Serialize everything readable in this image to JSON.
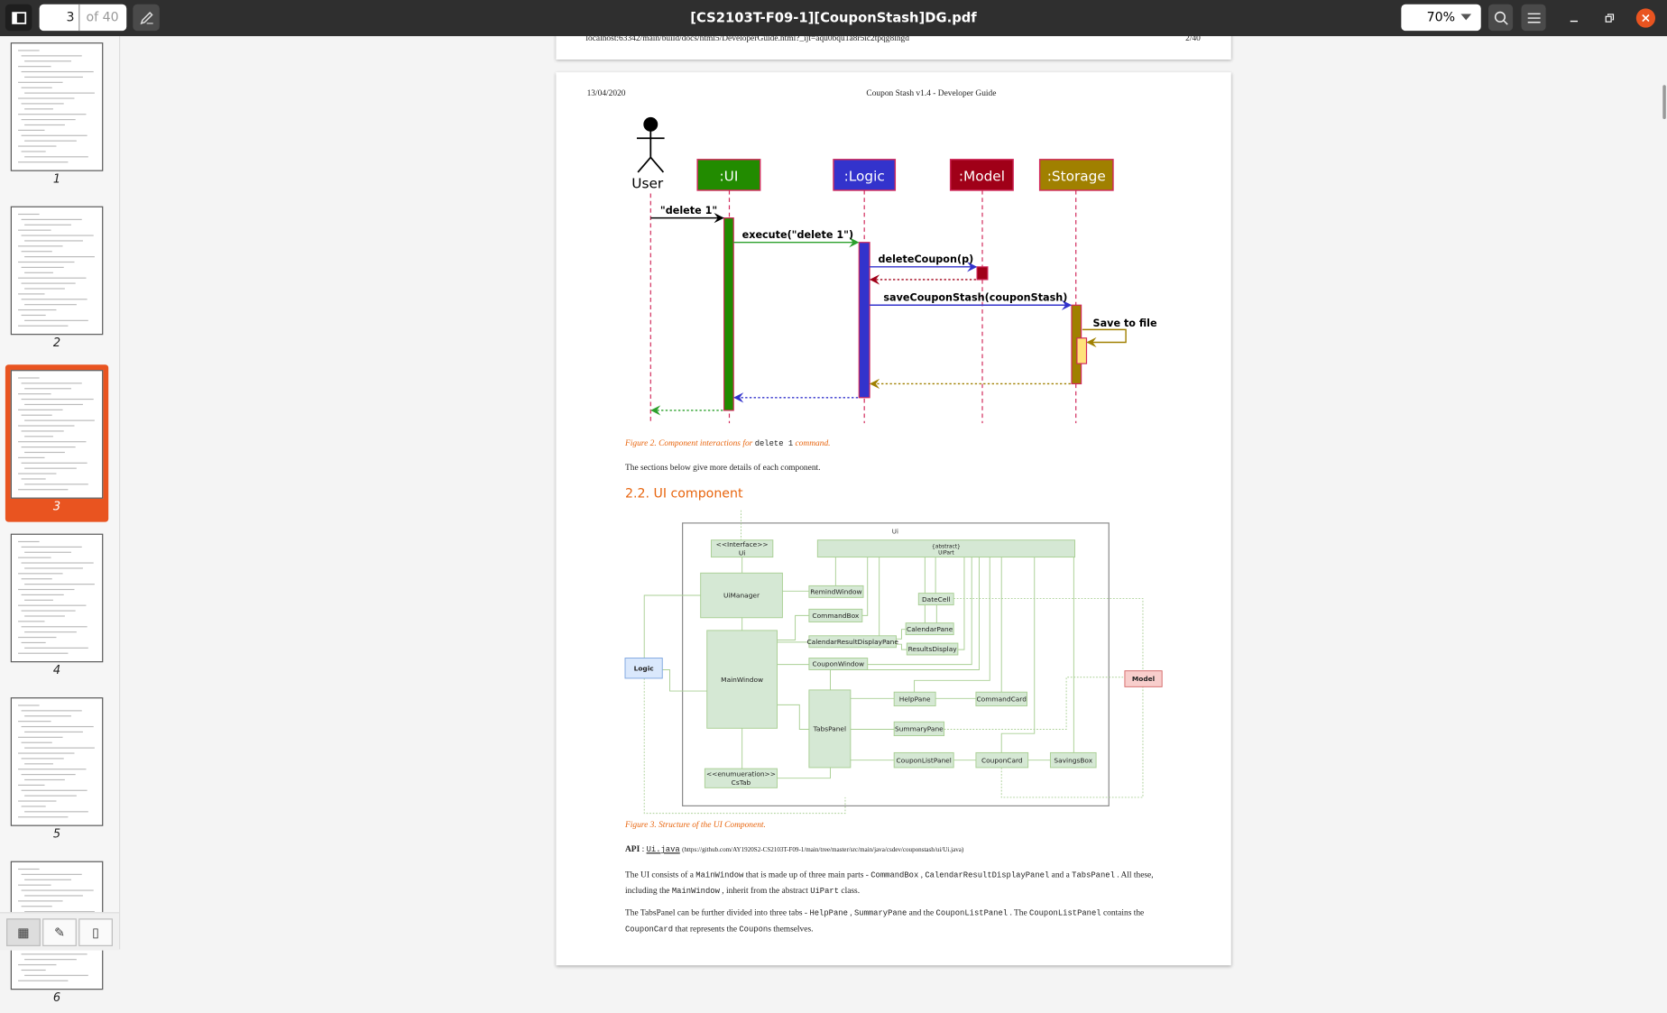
{
  "toolbar": {
    "current_page": "3",
    "page_count": "of 40",
    "document_title": "[CS2103T-F09-1][CouponStash]DG.pdf",
    "zoom_level": "70%"
  },
  "sidebar": {
    "thumbnails": [
      {
        "label": "1"
      },
      {
        "label": "2"
      },
      {
        "label": "3",
        "selected": true
      },
      {
        "label": "4"
      },
      {
        "label": "5"
      },
      {
        "label": "6"
      }
    ]
  },
  "page2_footer": {
    "url": "localhost:63342/main/build/docs/html5/DeveloperGuide.html?_ijt=aqu0bqu1a8r5ic2tpqg8lngd",
    "page": "2/40"
  },
  "page3": {
    "header_date": "13/04/2020",
    "header_title": "Coupon Stash v1.4 - Developer Guide",
    "sequence": {
      "actor": "User",
      "participants": [
        {
          "label": ":UI",
          "color": "#228b00"
        },
        {
          "label": ":Logic",
          "color": "#3333cc"
        },
        {
          "label": ":Model",
          "color": "#a00018"
        },
        {
          "label": ":Storage",
          "color": "#a08000"
        }
      ],
      "messages": [
        "\"delete 1\"",
        "execute(\"delete 1\")",
        "deleteCoupon(p)",
        "saveCouponStash(couponStash)",
        "Save to file"
      ]
    },
    "fig2_caption": {
      "pre": "Figure 2. Component interactions for ",
      "code": "delete 1",
      "post": " command."
    },
    "sections_text": "The sections below give more details of each component.",
    "heading": "2.2. UI component",
    "class_diagram": {
      "frame_label": "Ui",
      "boxes": [
        "<<Interface>>",
        "Ui",
        "{abstract}",
        "UiPart",
        "UiManager",
        "MainWindow",
        "RemindWindow",
        "CommandBox",
        "CalendarResultDisplayPane",
        "CouponWindow",
        "DateCell",
        "CalendarPane",
        "ResultsDisplay",
        "TabsPanel",
        "HelpPane",
        "CommandCard",
        "SummaryPane",
        "CouponListPanel",
        "CouponCard",
        "SavingsBox",
        "<<enumueration>>",
        "CsTab",
        "Logic",
        "Model"
      ]
    },
    "fig3_caption": "Figure 3. Structure of the UI Component.",
    "api": {
      "label": "API",
      "link": "Ui.java",
      "url": "(https://github.com/AY1920S2-CS2103T-F09-1/main/tree/master/src/main/java/csdev/couponstash/ui/Ui.java)"
    },
    "paragraphs": [
      [
        {
          "t": "The UI consists of a "
        },
        {
          "c": "MainWindow"
        },
        {
          "t": " that is made up of three main parts - "
        },
        {
          "c": "CommandBox"
        },
        {
          "t": " , "
        },
        {
          "c": "CalendarResultDisplayPanel"
        },
        {
          "t": " and a "
        },
        {
          "c": "TabsPanel"
        },
        {
          "t": " . All these, including the "
        },
        {
          "c": "MainWindow"
        },
        {
          "t": " , inherit from the abstract "
        },
        {
          "c": "UiPart"
        },
        {
          "t": " class."
        }
      ],
      [
        {
          "t": "The TabsPanel can be further divided into three tabs - "
        },
        {
          "c": "HelpPane"
        },
        {
          "t": " , "
        },
        {
          "c": "SummaryPane"
        },
        {
          "t": " and the "
        },
        {
          "c": "CouponListPanel"
        },
        {
          "t": " . The "
        },
        {
          "c": "CouponListPanel"
        },
        {
          "t": " contains the "
        },
        {
          "c": "CouponCard"
        },
        {
          "t": " that represents the "
        },
        {
          "c": "Coupon"
        },
        {
          "t": "s themselves."
        }
      ]
    ]
  },
  "colors": {
    "accent": "#e95420",
    "heading": "#e8650e",
    "uml_green": "#d5e8d4",
    "uml_border": "#a9cf94",
    "logic_fill": "#dae8fc",
    "model_fill": "#f8cecc"
  }
}
